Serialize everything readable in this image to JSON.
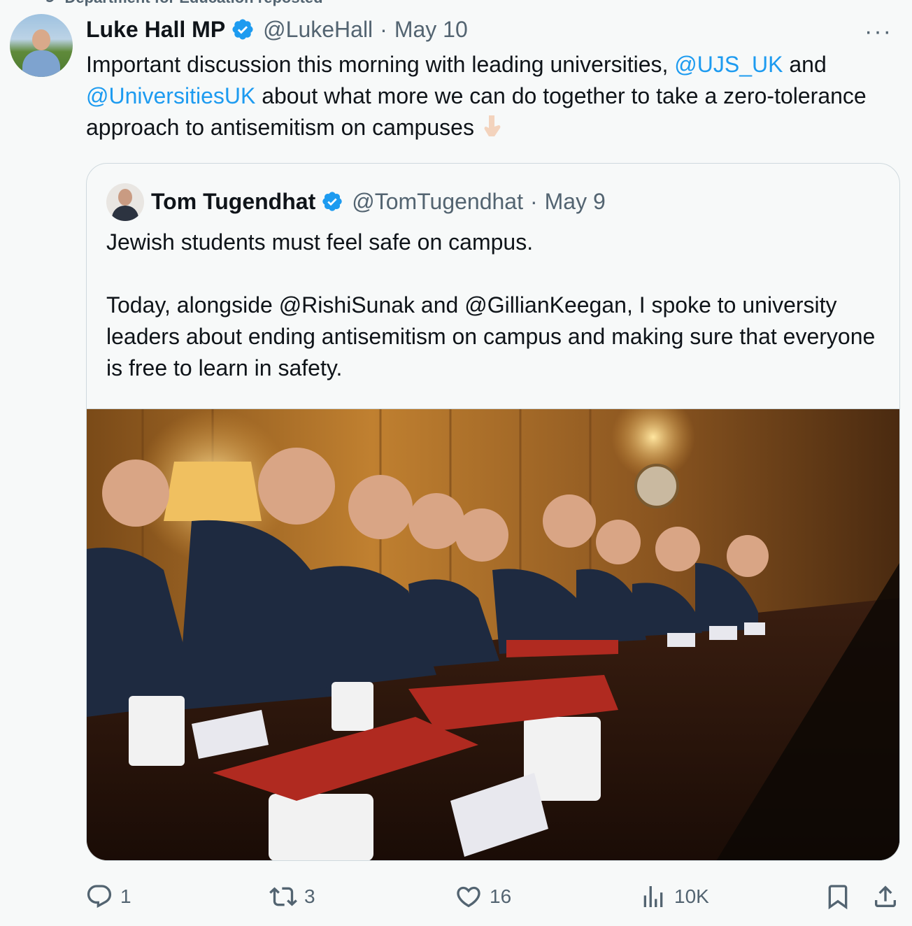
{
  "repost": {
    "label": "Department for Education reposted"
  },
  "tweet": {
    "name": "Luke Hall MP",
    "handle": "@LukeHall",
    "separator": "·",
    "date": "May 10",
    "more_label": "···",
    "text_before": "Important discussion this morning with leading universities, ",
    "mention_1": "@UJS_UK",
    "text_middle": " and ",
    "mention_2": "@UniversitiesUK",
    "text_after": " about what more we can do together to take a zero-tolerance approach to antisemitism on campuses"
  },
  "quote": {
    "name": "Tom Tugendhat",
    "handle": "@TomTugendhat",
    "separator": "·",
    "date": "May 9",
    "paragraph_1": "Jewish students must feel safe on campus.",
    "paragraph_2": "Today, alongside @RishiSunak and @GillianKeegan, I spoke to university leaders about ending antisemitism on campus and making sure that everyone is free to learn in safety."
  },
  "actions": {
    "replies": "1",
    "reposts": "3",
    "likes": "16",
    "views": "10K"
  },
  "colors": {
    "link": "#1d9bf0",
    "secondary_text": "#536471",
    "verified": "#1d9bf0"
  },
  "icons": [
    "reply-icon",
    "repost-icon",
    "like-icon",
    "views-icon",
    "bookmark-icon",
    "share-icon",
    "verified-badge-icon",
    "pointing-down-emoji"
  ]
}
